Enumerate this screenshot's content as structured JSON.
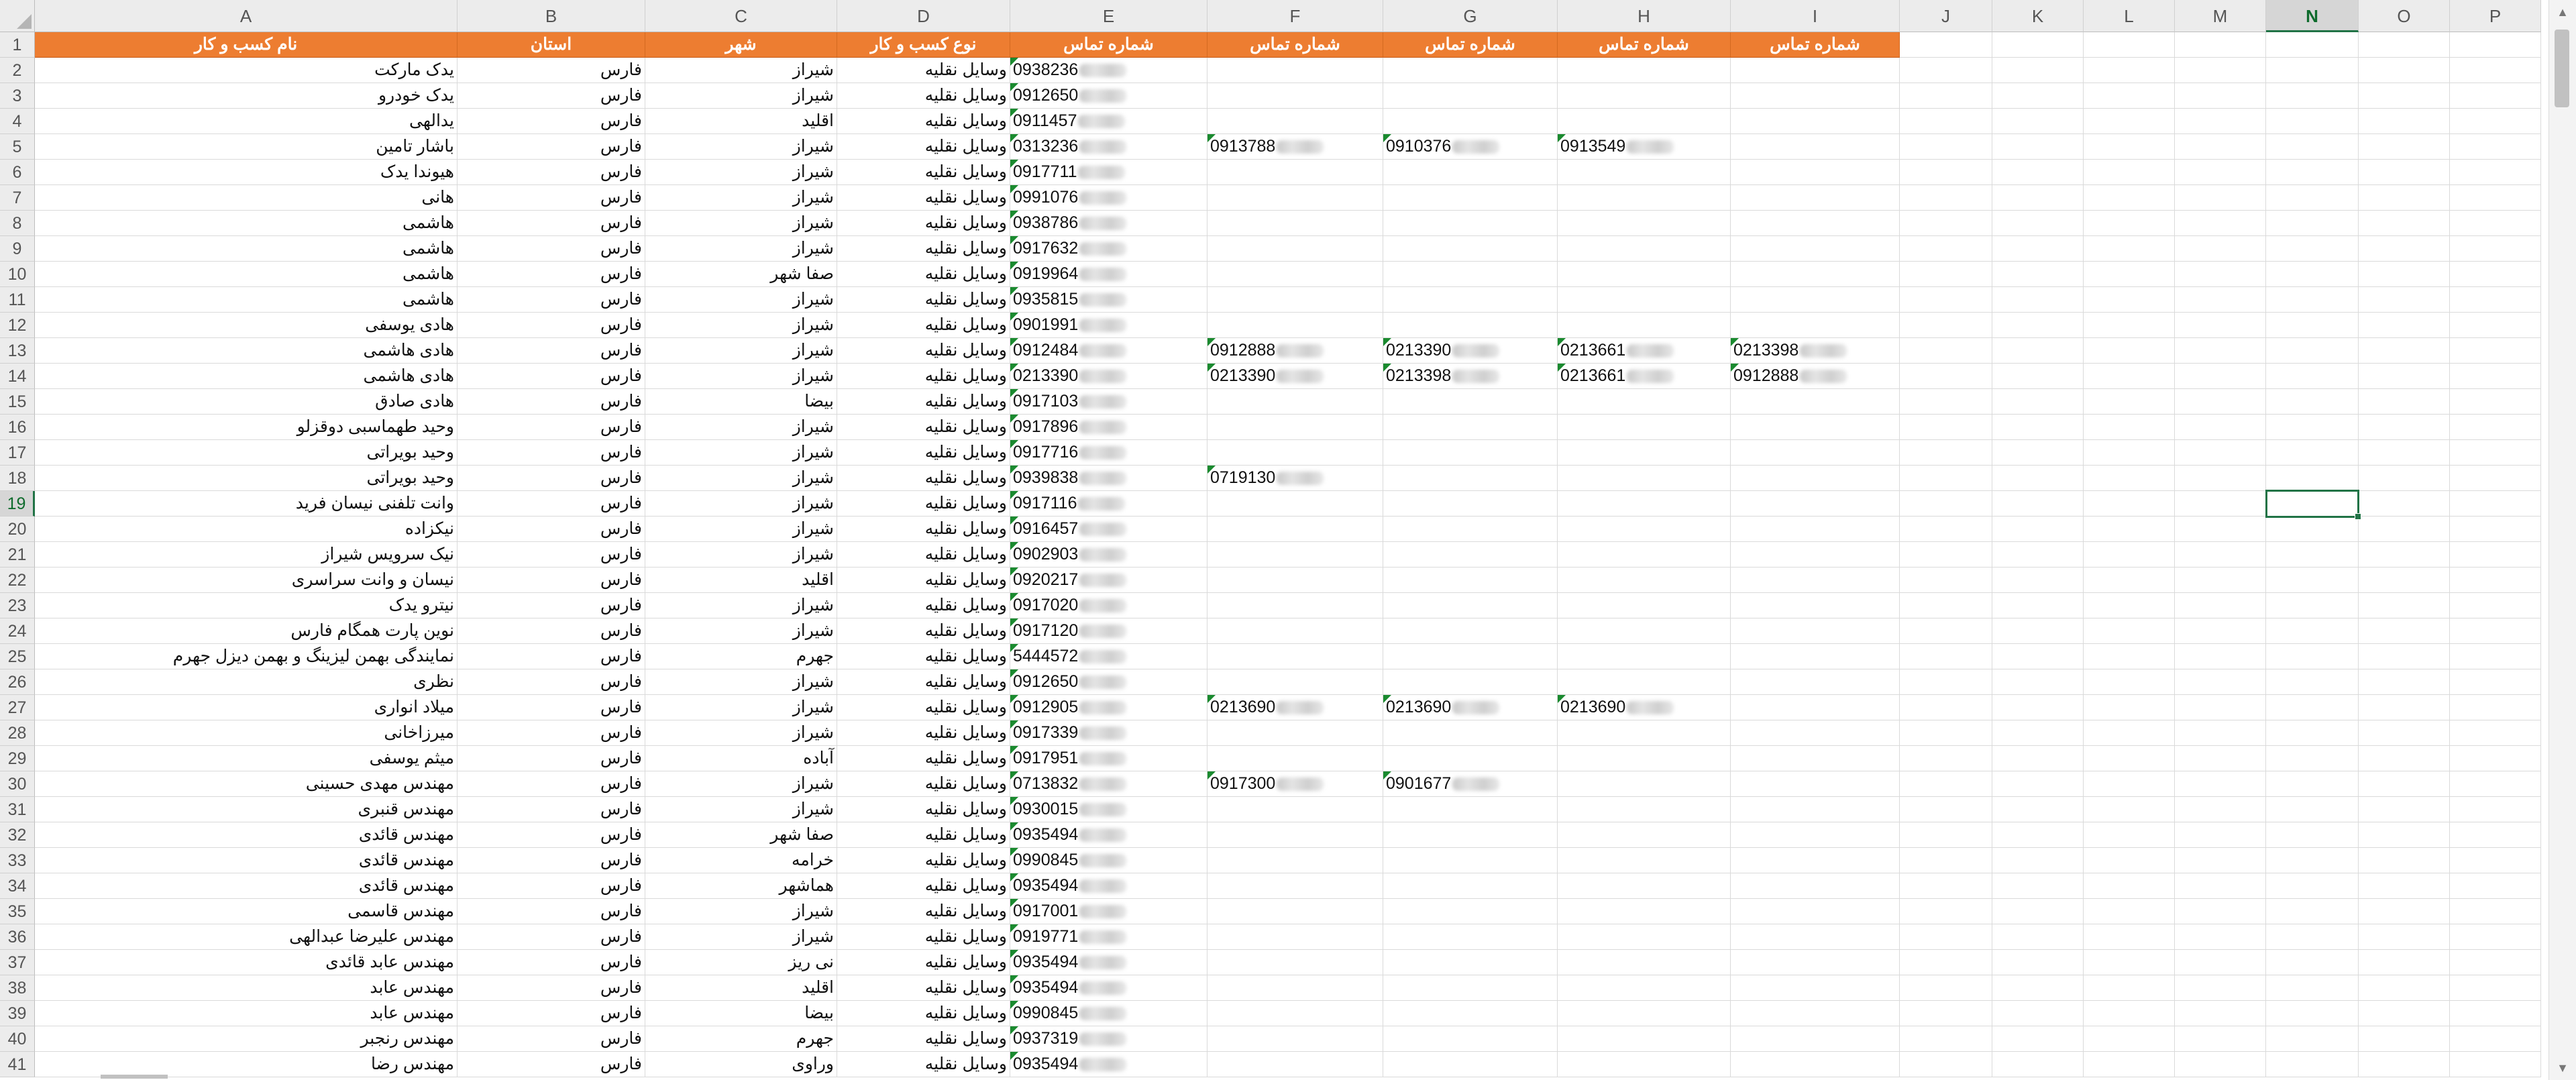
{
  "columns": [
    "A",
    "B",
    "C",
    "D",
    "E",
    "F",
    "G",
    "H",
    "I",
    "J",
    "K",
    "L",
    "M",
    "N",
    "O",
    "P"
  ],
  "selected_column": "N",
  "selected_row": 19,
  "header_row": {
    "A": "نام کسب و کار",
    "B": "استان",
    "C": "شهر",
    "D": "نوع کسب و کار",
    "E": "شماره تماس",
    "F": "شماره تماس",
    "G": "شماره تماس",
    "H": "شماره تماس",
    "I": "شماره تماس"
  },
  "rows": [
    {
      "n": 2,
      "A": "یدک مارکت",
      "B": "فارس",
      "C": "شیراز",
      "D": "وسایل نقلیه",
      "E": "0938236"
    },
    {
      "n": 3,
      "A": "یدک خودرو",
      "B": "فارس",
      "C": "شیراز",
      "D": "وسایل نقلیه",
      "E": "0912650"
    },
    {
      "n": 4,
      "A": "یدالهی",
      "B": "فارس",
      "C": "اقلید",
      "D": "وسایل نقلیه",
      "E": "0911457"
    },
    {
      "n": 5,
      "A": "باشار تامین",
      "B": "فارس",
      "C": "شیراز",
      "D": "وسایل نقلیه",
      "E": "0313236",
      "F": "0913788",
      "G": "0910376",
      "H": "0913549"
    },
    {
      "n": 6,
      "A": "هیوندا یدک",
      "B": "فارس",
      "C": "شیراز",
      "D": "وسایل نقلیه",
      "E": "0917711"
    },
    {
      "n": 7,
      "A": "هانی",
      "B": "فارس",
      "C": "شیراز",
      "D": "وسایل نقلیه",
      "E": "0991076"
    },
    {
      "n": 8,
      "A": "هاشمی",
      "B": "فارس",
      "C": "شیراز",
      "D": "وسایل نقلیه",
      "E": "0938786"
    },
    {
      "n": 9,
      "A": "هاشمی",
      "B": "فارس",
      "C": "شیراز",
      "D": "وسایل نقلیه",
      "E": "0917632"
    },
    {
      "n": 10,
      "A": "هاشمی",
      "B": "فارس",
      "C": "صفا شهر",
      "D": "وسایل نقلیه",
      "E": "0919964"
    },
    {
      "n": 11,
      "A": "هاشمی",
      "B": "فارس",
      "C": "شیراز",
      "D": "وسایل نقلیه",
      "E": "0935815"
    },
    {
      "n": 12,
      "A": "هادی یوسفی",
      "B": "فارس",
      "C": "شیراز",
      "D": "وسایل نقلیه",
      "E": "0901991"
    },
    {
      "n": 13,
      "A": "هادی هاشمی",
      "B": "فارس",
      "C": "شیراز",
      "D": "وسایل نقلیه",
      "E": "0912484",
      "F": "0912888",
      "G": "0213390",
      "H": "0213661",
      "I": "0213398"
    },
    {
      "n": 14,
      "A": "هادی هاشمی",
      "B": "فارس",
      "C": "شیراز",
      "D": "وسایل نقلیه",
      "E": "0213390",
      "F": "0213390",
      "G": "0213398",
      "H": "0213661",
      "I": "0912888"
    },
    {
      "n": 15,
      "A": "هادی صادق",
      "B": "فارس",
      "C": "بیضا",
      "D": "وسایل نقلیه",
      "E": "0917103"
    },
    {
      "n": 16,
      "A": "وحید طهماسبی دوقزلو",
      "B": "فارس",
      "C": "شیراز",
      "D": "وسایل نقلیه",
      "E": "0917896"
    },
    {
      "n": 17,
      "A": "وحید بویراتی",
      "B": "فارس",
      "C": "شیراز",
      "D": "وسایل نقلیه",
      "E": "0917716"
    },
    {
      "n": 18,
      "A": "وحید بویراتی",
      "B": "فارس",
      "C": "شیراز",
      "D": "وسایل نقلیه",
      "E": "0939838",
      "F": "0719130"
    },
    {
      "n": 19,
      "A": "وانت تلفنی نیسان فرید",
      "B": "فارس",
      "C": "شیراز",
      "D": "وسایل نقلیه",
      "E": "0917116"
    },
    {
      "n": 20,
      "A": "نیکزاده",
      "B": "فارس",
      "C": "شیراز",
      "D": "وسایل نقلیه",
      "E": "0916457"
    },
    {
      "n": 21,
      "A": "نیک سرویس شیراز",
      "B": "فارس",
      "C": "شیراز",
      "D": "وسایل نقلیه",
      "E": "0902903"
    },
    {
      "n": 22,
      "A": "نیسان و وانت سراسری",
      "B": "فارس",
      "C": "اقلید",
      "D": "وسایل نقلیه",
      "E": "0920217"
    },
    {
      "n": 23,
      "A": "نیترو یدک",
      "B": "فارس",
      "C": "شیراز",
      "D": "وسایل نقلیه",
      "E": "0917020"
    },
    {
      "n": 24,
      "A": "نوین پارت همگام فارس",
      "B": "فارس",
      "C": "شیراز",
      "D": "وسایل نقلیه",
      "E": "0917120"
    },
    {
      "n": 25,
      "A": "نمایندگی بهمن لیزینگ و بهمن دیزل جهرم",
      "B": "فارس",
      "C": "جهرم",
      "D": "وسایل نقلیه",
      "E": "5444572"
    },
    {
      "n": 26,
      "A": "نظری",
      "B": "فارس",
      "C": "شیراز",
      "D": "وسایل نقلیه",
      "E": "0912650"
    },
    {
      "n": 27,
      "A": "میلاد انواری",
      "B": "فارس",
      "C": "شیراز",
      "D": "وسایل نقلیه",
      "E": "0912905",
      "F": "0213690",
      "G": "0213690",
      "H": "0213690"
    },
    {
      "n": 28,
      "A": "میرزاخانی",
      "B": "فارس",
      "C": "شیراز",
      "D": "وسایل نقلیه",
      "E": "0917339"
    },
    {
      "n": 29,
      "A": "میثم یوسفی",
      "B": "فارس",
      "C": "آباده",
      "D": "وسایل نقلیه",
      "E": "0917951"
    },
    {
      "n": 30,
      "A": "مهندس مهدی حسینی",
      "B": "فارس",
      "C": "شیراز",
      "D": "وسایل نقلیه",
      "E": "0713832",
      "F": "0917300",
      "G": "0901677"
    },
    {
      "n": 31,
      "A": "مهندس قنبری",
      "B": "فارس",
      "C": "شیراز",
      "D": "وسایل نقلیه",
      "E": "0930015"
    },
    {
      "n": 32,
      "A": "مهندس قائدی",
      "B": "فارس",
      "C": "صفا شهر",
      "D": "وسایل نقلیه",
      "E": "0935494"
    },
    {
      "n": 33,
      "A": "مهندس قائدی",
      "B": "فارس",
      "C": "خرامه",
      "D": "وسایل نقلیه",
      "E": "0990845"
    },
    {
      "n": 34,
      "A": "مهندس قائدی",
      "B": "فارس",
      "C": "هماشهر",
      "D": "وسایل نقلیه",
      "E": "0935494"
    },
    {
      "n": 35,
      "A": "مهندس قاسمی",
      "B": "فارس",
      "C": "شیراز",
      "D": "وسایل نقلیه",
      "E": "0917001"
    },
    {
      "n": 36,
      "A": "مهندس علیرضا عبدالهی",
      "B": "فارس",
      "C": "شیراز",
      "D": "وسایل نقلیه",
      "E": "0919771"
    },
    {
      "n": 37,
      "A": "مهندس عابد قائدی",
      "B": "فارس",
      "C": "نی ریز",
      "D": "وسایل نقلیه",
      "E": "0935494"
    },
    {
      "n": 38,
      "A": "مهندس عابد",
      "B": "فارس",
      "C": "اقلید",
      "D": "وسایل نقلیه",
      "E": "0935494"
    },
    {
      "n": 39,
      "A": "مهندس عابد",
      "B": "فارس",
      "C": "بیضا",
      "D": "وسایل نقلیه",
      "E": "0990845"
    },
    {
      "n": 40,
      "A": "مهندس رنجبر",
      "B": "فارس",
      "C": "جهرم",
      "D": "وسایل نقلیه",
      "E": "0937319"
    },
    {
      "n": 41,
      "A": "مهندس رضا",
      "B": "فارس",
      "C": "وراوی",
      "D": "وسایل نقلیه",
      "E": "0935494"
    }
  ],
  "colors": {
    "header_fill": "#ed7d31",
    "header_text": "#ffffff",
    "selection": "#217346",
    "comment_marker": "#1a8a2f"
  },
  "icons": {
    "scroll_up": "scroll-up-arrow-icon",
    "scroll_down": "scroll-down-arrow-icon",
    "select_all": "select-all-corner-icon"
  }
}
